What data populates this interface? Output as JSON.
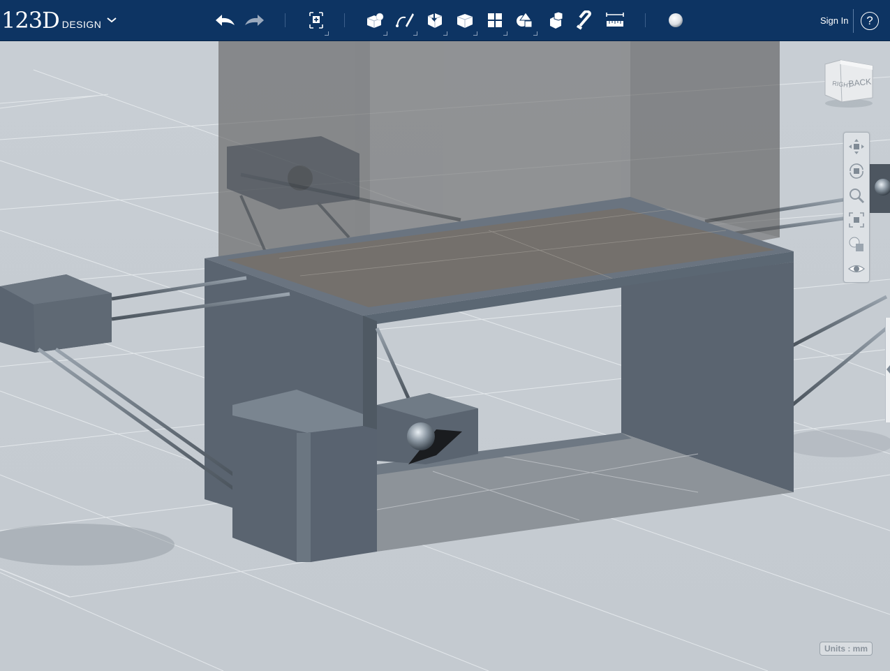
{
  "app": {
    "logo_main": "123D",
    "logo_sub": "DESIGN",
    "menu_icon": "chevron-down-icon"
  },
  "toolbar": {
    "undo_icon": "undo-icon",
    "redo_icon": "redo-icon",
    "transform_icon": "transform-icon",
    "primitives_icon": "primitives-icon",
    "sketch_icon": "sketch-icon",
    "construct_icon": "construct-icon",
    "modify_icon": "modify-icon",
    "pattern_icon": "pattern-icon",
    "grouping_icon": "grouping-icon",
    "combine_icon": "combine-icon",
    "snap_icon": "snap-magnet-icon",
    "measure_icon": "measure-ruler-icon",
    "material_icon": "material-sphere-icon",
    "sign_in": "Sign In",
    "help": "?"
  },
  "viewcube": {
    "face_right": "RIGHT",
    "face_back": "BACK"
  },
  "navbar": {
    "items": [
      "pan-icon",
      "orbit-icon",
      "zoom-icon",
      "fit-icon",
      "materials-outline-icon",
      "visibility-eye-icon"
    ]
  },
  "status": {
    "units": "Units : mm"
  },
  "colors": {
    "toolbar_bg": "#0d3463",
    "viewport_bg": "#c6ccd2",
    "model_gray": "#5a6470",
    "transparent_box": "#6b6b6b"
  }
}
